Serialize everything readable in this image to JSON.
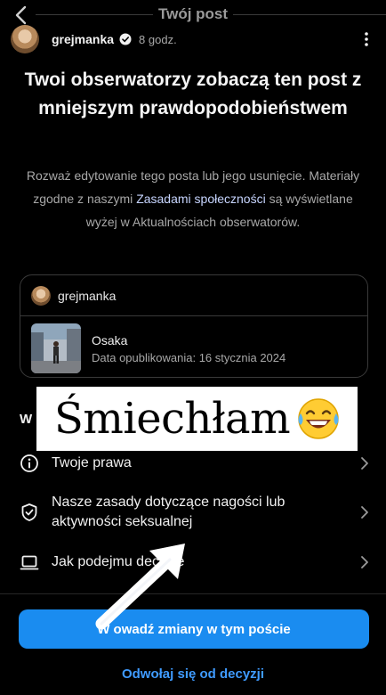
{
  "topbar": {
    "title": "Twój post"
  },
  "header": {
    "username": "grejmanka",
    "time": "8 godz."
  },
  "headline": "Twoi obserwatorzy zobaczą ten post z mniejszym prawdopodobieństwem",
  "description": {
    "part1": "Rozważ edytowanie tego posta lub jego usunięcie. Materiały zgodne z naszymi ",
    "link": "Zasadami społeczności",
    "part2": " są wyświetlane wyżej w Aktualnościach obserwatorów."
  },
  "card": {
    "username": "grejmanka",
    "location": "Osaka",
    "date": "Data opublikowania: 16 stycznia 2024"
  },
  "section_peek": "W",
  "menu": {
    "rights": "Twoje prawa",
    "policy": "Nasze zasady dotyczące nagości lub aktywności seksualnej",
    "decisions": "Jak podejmu decyzje"
  },
  "buttons": {
    "primary": "W owadź zmiany w tym poście",
    "appeal": "Odwołaj się od decyzji"
  },
  "overlay": {
    "text": "Śmiechłam"
  },
  "colors": {
    "accent": "#1a8cf0",
    "link": "#3f9bff",
    "background": "#000000"
  }
}
